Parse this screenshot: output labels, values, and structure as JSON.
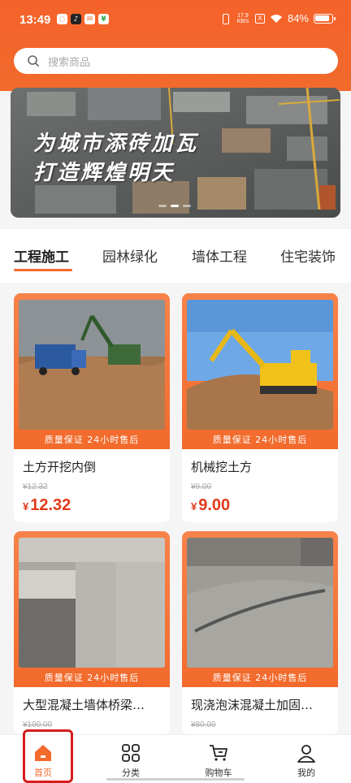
{
  "status_bar": {
    "time": "13:49",
    "net_speed_value": "17.9",
    "net_speed_unit": "KB/s",
    "sim": "X",
    "battery": "84%"
  },
  "search": {
    "placeholder": "搜索商品"
  },
  "banner": {
    "line1": "为城市添砖加瓦",
    "line2": "打造辉煌明天",
    "slide_count": 3,
    "active_slide": 2
  },
  "tabs": [
    {
      "label": "工程施工",
      "active": true
    },
    {
      "label": "园林绿化",
      "active": false
    },
    {
      "label": "墙体工程",
      "active": false
    },
    {
      "label": "住宅装饰",
      "active": false
    }
  ],
  "products": [
    {
      "tag": "质量保证 24小时售后",
      "title": "土方开挖内倒",
      "original_price": "¥12.32",
      "currency": "¥",
      "price": "12.32"
    },
    {
      "tag": "质量保证 24小时售后",
      "title": "机械挖土方",
      "original_price": "¥9.00",
      "currency": "¥",
      "price": "9.00"
    },
    {
      "tag": "质量保证 24小时售后",
      "title": "大型混凝土墙体桥梁…",
      "original_price": "¥100.00"
    },
    {
      "tag": "质量保证 24小时售后",
      "title": "现浇泡沫混凝土加固…",
      "original_price": "¥80.00"
    }
  ],
  "bottom_nav": [
    {
      "label": "首页",
      "icon": "home-icon",
      "active": true
    },
    {
      "label": "分类",
      "icon": "category-grid-icon",
      "active": false
    },
    {
      "label": "购物车",
      "icon": "cart-icon",
      "active": false
    },
    {
      "label": "我的",
      "icon": "user-icon",
      "active": false
    }
  ],
  "colors": {
    "brand": "#f26a2c",
    "price": "#e23a1a",
    "highlight_box": "#d81c1c"
  }
}
